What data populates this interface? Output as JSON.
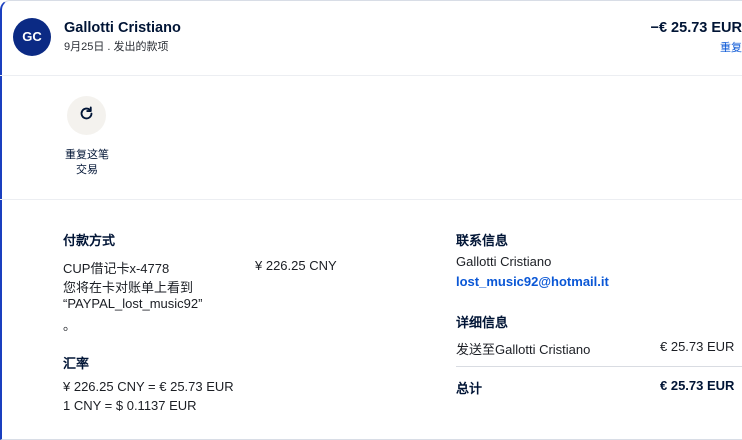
{
  "header": {
    "avatar_initials": "GC",
    "name": "Gallotti Cristiano",
    "subtitle": "9月25日 . 发出的款项",
    "amount": "−€ 25.73 EUR",
    "amount_link": "重复"
  },
  "actions": {
    "repeat_label": "重复这笔交易"
  },
  "payment": {
    "title": "付款方式",
    "card_name": "CUP借记卡x-4778",
    "card_amount": "¥ 226.25 CNY",
    "statement_line1": "您将在卡对账单上看到",
    "statement_line2": "“PAYPAL_lost_music92”",
    "statement_line3": "。"
  },
  "exchange": {
    "title": "汇率",
    "line1": "¥ 226.25 CNY = € 25.73 EUR",
    "line2": "1 CNY = $ 0.1137 EUR"
  },
  "contact": {
    "title": "联系信息",
    "name": "Gallotti Cristiano",
    "email": "lost_music92@hotmail.it"
  },
  "details": {
    "title": "详细信息",
    "sent_to_label": "发送至Gallotti Cristiano",
    "sent_to_amount": "€ 25.73 EUR",
    "total_label": "总计",
    "total_amount": "€ 25.73 EUR"
  },
  "colors": {
    "avatar_bg": "#0b2a84",
    "link": "#0a57d6",
    "text": "#001435"
  },
  "icons": {
    "repeat": "refresh-icon"
  }
}
